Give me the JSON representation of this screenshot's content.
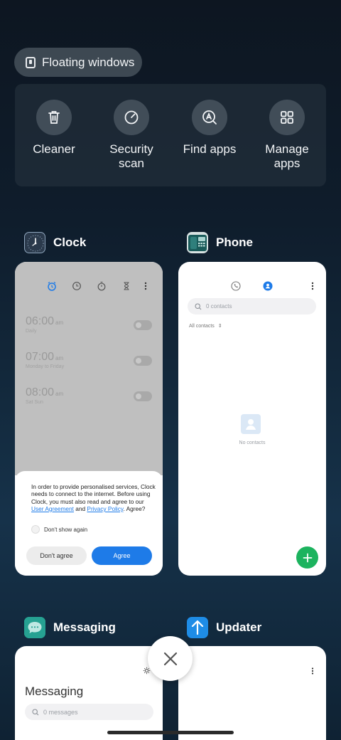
{
  "floating_windows": {
    "label": "Floating windows"
  },
  "quick_actions": [
    {
      "label_1": "Cleaner",
      "label_2": "",
      "icon": "trash-icon"
    },
    {
      "label_1": "Security",
      "label_2": "scan",
      "icon": "security-scan-icon"
    },
    {
      "label_1": "Find apps",
      "label_2": "",
      "icon": "find-apps-icon"
    },
    {
      "label_1": "Manage",
      "label_2": "apps",
      "icon": "manage-apps-icon"
    }
  ],
  "apps": {
    "clock": {
      "name": "Clock",
      "alarms": [
        {
          "time": "06:00",
          "ampm": "am",
          "repeat": "Daily"
        },
        {
          "time": "07:00",
          "ampm": "am",
          "repeat": "Monday to Friday"
        },
        {
          "time": "08:00",
          "ampm": "am",
          "repeat": "Sat Sun"
        }
      ],
      "dialog": {
        "text_start": "In order to provide personalised services, Clock needs to connect to the internet. Before using Clock, you must also read and agree to our ",
        "link_1": "User Agreement",
        "text_mid": " and ",
        "link_2": "Privacy Policy",
        "text_end": ". Agree?",
        "checkbox": "Don't show again",
        "decline": "Don't agree",
        "accept": "Agree"
      }
    },
    "phone": {
      "name": "Phone",
      "search_placeholder": "0 contacts",
      "filter": "All contacts",
      "empty": "No contacts"
    },
    "messaging": {
      "name": "Messaging",
      "title": "Messaging",
      "search_placeholder": "0 messages"
    },
    "updater": {
      "name": "Updater"
    }
  },
  "colors": {
    "accent": "#1e7be8",
    "fab": "#1cb35e"
  }
}
